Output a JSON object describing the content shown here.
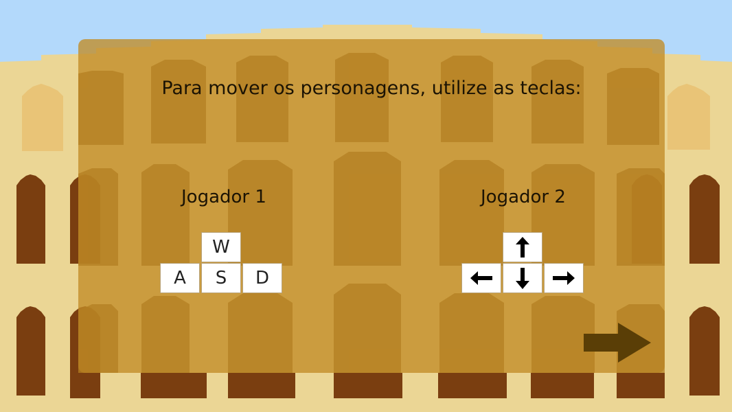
{
  "instructions": {
    "title": "Para mover os personagens, utilize as teclas:"
  },
  "player1": {
    "label": "Jogador 1",
    "keys": {
      "up": "W",
      "left": "A",
      "down": "S",
      "right": "D"
    }
  },
  "player2": {
    "label": "Jogador 2",
    "keys": {
      "up": "arrow-up-icon",
      "left": "arrow-left-icon",
      "down": "arrow-down-icon",
      "right": "arrow-right-icon"
    }
  },
  "navigation": {
    "next_icon": "arrow-right-icon"
  },
  "colors": {
    "sky": "#b3d9fb",
    "wall": "#e6cd82",
    "wall_light": "#edd99a",
    "arch_dark": "#7a3e10",
    "panel": "#c18c26",
    "next_arrow": "#5a3e06",
    "key_bg": "#ffffff"
  }
}
